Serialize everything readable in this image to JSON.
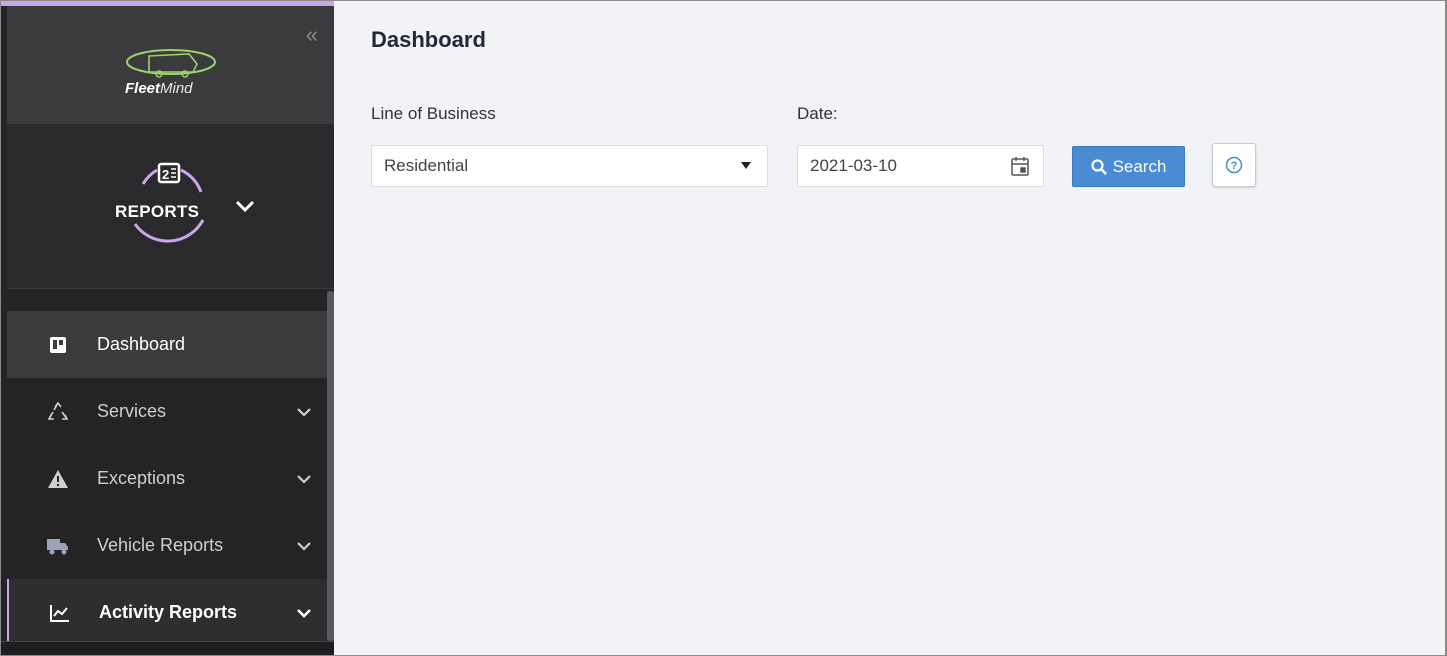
{
  "sidebar": {
    "brand": {
      "name_bold": "Fleet",
      "name_regular": "Mind"
    },
    "module": {
      "label": "REPORTS",
      "icon": "reports-module-icon"
    },
    "collapse_icon": "double-chevron-left-icon",
    "items": [
      {
        "label": "Dashboard",
        "icon": "board-icon",
        "active": true,
        "has_submenu": false
      },
      {
        "label": "Services",
        "icon": "recycle-icon",
        "active": false,
        "has_submenu": true
      },
      {
        "label": "Exceptions",
        "icon": "warning-icon",
        "active": false,
        "has_submenu": true
      },
      {
        "label": "Vehicle Reports",
        "icon": "truck-icon",
        "active": false,
        "has_submenu": true
      },
      {
        "label": "Activity Reports",
        "icon": "line-chart-icon",
        "active": false,
        "has_submenu": true
      }
    ]
  },
  "main": {
    "title": "Dashboard",
    "line_of_business": {
      "label": "Line of Business",
      "value": "Residential"
    },
    "date": {
      "label": "Date:",
      "value": "2021-03-10"
    },
    "search_label": "Search"
  },
  "colors": {
    "sidebar_bg": "#242426",
    "accent": "#c9a6ea",
    "primary_button": "#4a8bd4",
    "content_bg": "#f1f3f6"
  }
}
